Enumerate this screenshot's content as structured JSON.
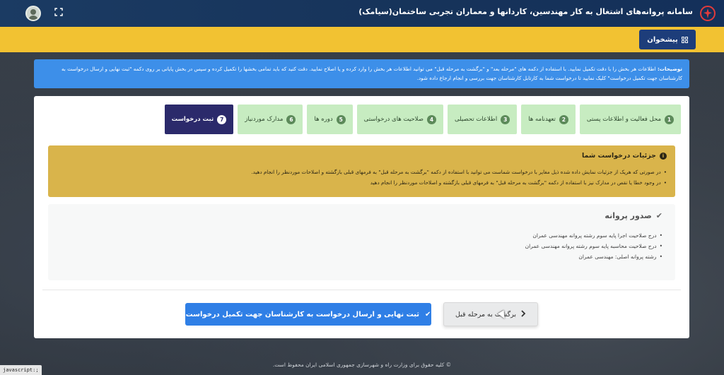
{
  "header": {
    "title": "سامانه پروانه‌های اشتغال به کار مهندسین، کاردانها و معماران تجربی ساختمان(سیامک)"
  },
  "toolbar": {
    "dashboard_label": "پیشخوان"
  },
  "notice": {
    "label": "توضیحات:",
    "text": "اطلاعات هر بخش را با دقت تکمیل نمایید. با استفاده از دکمه های \"مرحله بعد\" و \"برگشت به مرحله قبل\" می توانید اطلاعات هر بخش را وارد کرده و یا اصلاح نمایید. دقت کنید که باید تمامی بخشها را تکمیل کرده و سپس در بخش پایانی بر روی دکمه \"ثبت نهایی و ارسال درخواست به کارشناسان جهت تکمیل درخواست\" کلیک نمایید تا درخواست شما به کارتابل کارشناسان جهت بررسی و انجام ارجاع داده شود."
  },
  "steps": [
    {
      "num": "1",
      "label": "محل فعالیت و اطلاعات پستی",
      "active": false
    },
    {
      "num": "2",
      "label": "تعهدنامه ها",
      "active": false
    },
    {
      "num": "3",
      "label": "اطلاعات تحصیلی",
      "active": false
    },
    {
      "num": "4",
      "label": "صلاحیت های درخواستی",
      "active": false
    },
    {
      "num": "5",
      "label": "دوره ها",
      "active": false
    },
    {
      "num": "6",
      "label": "مدارک موردنیاز",
      "active": false
    },
    {
      "num": "7",
      "label": "ثبت درخواست",
      "active": true
    }
  ],
  "details": {
    "title": "جزئیات درخواست شما",
    "items": [
      "در صورتی که هریک از جزئیات نمایش داده شده ذیل مغایر با درخواست شماست می توانید با استفاده از دکمه \"برگشت به مرحله قبل\" به فرمهای قبلی بازگشته و اصلاحات موردنظر را انجام دهید.",
      "در وجود خطا یا نقص در مدارک نیز با استفاده از دکمه \"برگشت به مرحله قبل\" به فرمهای قبلی بازگشته و اصلاحات موردنظر را انجام دهید"
    ]
  },
  "license": {
    "title": "صدور پروانه",
    "items": [
      "درج صلاحیت اجرا پایه سوم رشته پروانه مهندسی عمران",
      "درج صلاحیت محاسبه پایه سوم رشته پروانه مهندسی عمران",
      "رشته پروانه اصلی: مهندسی عمران"
    ]
  },
  "actions": {
    "back_label": "برگشت به مرحله قبل",
    "submit_label": "ثبت نهایی و ارسال درخواست به کارشناسان جهت تکمیل درخواست"
  },
  "footer": {
    "text": "© کلیه حقوق برای وزارت راه و شهرسازی جمهوری اسلامی ایران محفوظ است."
  },
  "statusbar": {
    "text": "javascript:;"
  },
  "colors": {
    "header_bg": "#16335a",
    "yellow_bar": "#f2c232",
    "notice_bg": "#3d8fe9",
    "step_done": "#c7ecc1",
    "step_active": "#2b2a6b",
    "details_bg": "#d9b44b",
    "submit_bg": "#2f7fe6"
  }
}
